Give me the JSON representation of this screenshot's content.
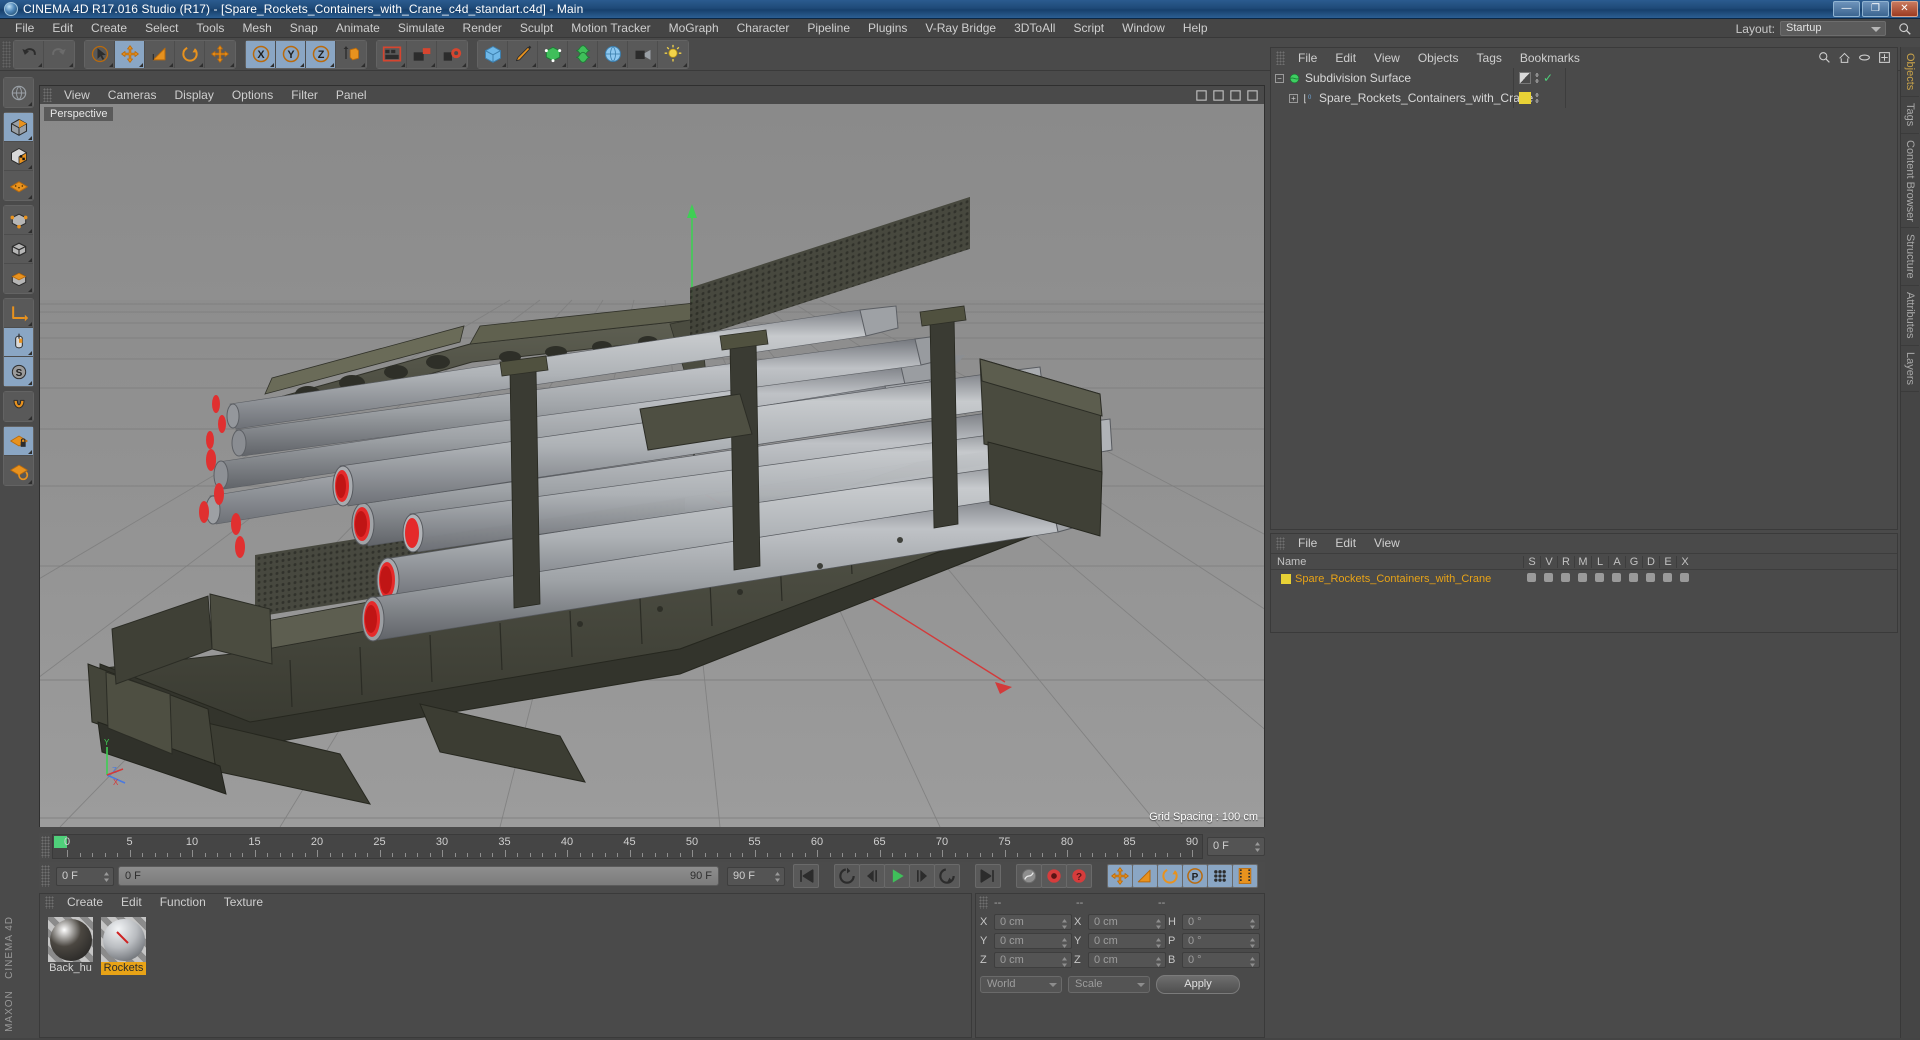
{
  "window": {
    "title": "CINEMA 4D R17.016 Studio (R17) - [Spare_Rockets_Containers_with_Crane_c4d_standart.c4d] - Main",
    "minimize": "—",
    "maximize": "❐",
    "close": "✕"
  },
  "menubar": {
    "items": [
      "File",
      "Edit",
      "Create",
      "Select",
      "Tools",
      "Mesh",
      "Snap",
      "Animate",
      "Simulate",
      "Render",
      "Sculpt",
      "Motion Tracker",
      "MoGraph",
      "Character",
      "Pipeline",
      "Plugins",
      "V-Ray Bridge",
      "3DToAll",
      "Script",
      "Window",
      "Help"
    ],
    "layout_label": "Layout:",
    "layout_value": "Startup",
    "search_icon": "search-icon"
  },
  "toolbar": {
    "groups": [
      {
        "name": "undo-redo",
        "buttons": [
          {
            "icon": "undo-icon",
            "label": "Undo",
            "selected": false
          },
          {
            "icon": "redo-icon",
            "label": "Redo",
            "selected": false
          }
        ]
      },
      {
        "name": "transform-tools",
        "buttons": [
          {
            "icon": "select-cursor-icon",
            "label": "Live Selection",
            "selected": false
          },
          {
            "icon": "move-icon",
            "label": "Move",
            "selected": true
          },
          {
            "icon": "scale-icon",
            "label": "Scale",
            "selected": false
          },
          {
            "icon": "rotate-icon",
            "label": "Rotate",
            "selected": false
          },
          {
            "icon": "move-axis-icon",
            "label": "Move Axis",
            "selected": false
          }
        ]
      },
      {
        "name": "axis-locks",
        "buttons": [
          {
            "icon": "x-axis-icon",
            "label": "X Axis",
            "selected": true
          },
          {
            "icon": "y-axis-icon",
            "label": "Y Axis",
            "selected": true
          },
          {
            "icon": "z-axis-icon",
            "label": "Z Axis",
            "selected": true
          },
          {
            "icon": "world-object-coord-icon",
            "label": "World/Object",
            "selected": false
          }
        ]
      },
      {
        "name": "render-tools",
        "buttons": [
          {
            "icon": "render-view-icon",
            "label": "Render View",
            "selected": false
          },
          {
            "icon": "render-to-picture-viewer-icon",
            "label": "Render to Picture Viewer",
            "selected": false
          },
          {
            "icon": "render-settings-icon",
            "label": "Edit Render Settings",
            "selected": false
          }
        ]
      },
      {
        "name": "object-creation",
        "buttons": [
          {
            "icon": "cube-primitive-icon",
            "label": "Add Cube Object",
            "selected": false
          },
          {
            "icon": "pen-spline-icon",
            "label": "Add Spline",
            "selected": false
          },
          {
            "icon": "nurbs-generator-icon",
            "label": "Add Generator",
            "selected": false
          },
          {
            "icon": "deformer-icon",
            "label": "Add Deformer",
            "selected": false
          },
          {
            "icon": "environment-icon",
            "label": "Add Environment",
            "selected": false
          },
          {
            "icon": "camera-icon",
            "label": "Add Camera",
            "selected": false
          },
          {
            "icon": "light-icon",
            "label": "Add Light",
            "selected": false
          }
        ]
      }
    ]
  },
  "leftbar": {
    "buttons": [
      {
        "icon": "globe-tool-icon",
        "label": "Selection Mode",
        "selected": false
      },
      {
        "icon": "model-mode-icon",
        "label": "Model Mode",
        "selected": true
      },
      {
        "icon": "texture-mode-icon",
        "label": "Texture Mode",
        "selected": false
      },
      {
        "icon": "workplane-icon",
        "label": "Workplane Mode",
        "selected": false
      },
      {
        "icon": "points-mode-icon",
        "label": "Points Mode",
        "selected": false
      },
      {
        "icon": "edges-mode-icon",
        "label": "Edges Mode",
        "selected": false
      },
      {
        "icon": "polygons-mode-icon",
        "label": "Polygons Mode",
        "selected": false
      },
      {
        "icon": "axis-modify-icon",
        "label": "Enable Axis Modification",
        "selected": false
      },
      {
        "icon": "viewport-solo-icon",
        "label": "Viewport Solo",
        "selected": true
      },
      {
        "icon": "soft-selection-icon",
        "label": "Soft Selection",
        "selected": true
      },
      {
        "icon": "magnet-snap-icon",
        "label": "Enable Snapping",
        "selected": false
      },
      {
        "icon": "workplane-lock-icon",
        "label": "Lock Workplane",
        "selected": true
      },
      {
        "icon": "planar-workplane-icon",
        "label": "Planar Workplane",
        "selected": false
      }
    ],
    "brand_line1": "MAXON",
    "brand_line2": "CINEMA 4D"
  },
  "viewport": {
    "menu_items": [
      "View",
      "Cameras",
      "Display",
      "Options",
      "Filter",
      "Panel"
    ],
    "label": "Perspective",
    "grid_spacing": "Grid Spacing : 100 cm",
    "axis_x": "X",
    "axis_y": "Y",
    "axis_z": "Z"
  },
  "timeline": {
    "start_label": "0 F",
    "ticks": [
      0,
      5,
      10,
      15,
      20,
      25,
      30,
      35,
      40,
      45,
      50,
      55,
      60,
      65,
      70,
      75,
      80,
      85,
      90
    ],
    "frame_field": "0 F",
    "range_start": "0 F",
    "range_end": "90 F",
    "end_field": "90 F",
    "transport": [
      {
        "icon": "go-to-start-icon",
        "label": "Go to Start Frame",
        "selected": false
      },
      {
        "icon": "previous-key-icon",
        "label": "Go to Previous Key",
        "selected": false
      },
      {
        "icon": "step-back-icon",
        "label": "Go to Previous Frame",
        "selected": false
      },
      {
        "icon": "play-icon",
        "label": "Play Forwards",
        "selected": false
      },
      {
        "icon": "step-forward-icon",
        "label": "Go to Next Frame",
        "selected": false
      },
      {
        "icon": "next-key-icon",
        "label": "Go to Next Key",
        "selected": false
      },
      {
        "icon": "go-to-end-icon",
        "label": "Go to End Frame",
        "selected": false
      }
    ],
    "record_group": [
      {
        "icon": "autokey-icon",
        "label": "Autokeying",
        "selected": false
      },
      {
        "icon": "record-icon",
        "label": "Record Active Objects",
        "selected": false
      },
      {
        "icon": "keyframe-selection-icon",
        "label": "Keyframe Selection",
        "selected": false
      }
    ],
    "param_group": [
      {
        "icon": "position-key-icon",
        "label": "Position",
        "selected": true
      },
      {
        "icon": "scale-key-icon",
        "label": "Scale",
        "selected": true
      },
      {
        "icon": "rotation-key-icon",
        "label": "Rotation",
        "selected": true
      },
      {
        "icon": "param-key-icon",
        "label": "Parameter",
        "selected": true
      },
      {
        "icon": "pla-key-icon",
        "label": "Point Level Animation",
        "selected": true
      },
      {
        "icon": "timeline-icon",
        "label": "Timeline",
        "selected": true
      }
    ]
  },
  "material_manager": {
    "menu_items": [
      "Create",
      "Edit",
      "Function",
      "Texture"
    ],
    "materials": [
      {
        "name": "Back_hu",
        "selected": false,
        "color": "#4b4741"
      },
      {
        "name": "Rockets",
        "selected": true,
        "color": "#b9bcc0"
      }
    ]
  },
  "object_manager": {
    "menu_items": [
      "File",
      "Edit",
      "View",
      "Objects",
      "Tags",
      "Bookmarks"
    ],
    "header_icons": [
      "search-icon",
      "home-icon",
      "eye-icon",
      "expand-icon"
    ],
    "rows": [
      {
        "name": "Subdivision Surface",
        "depth": 0,
        "expander": "−",
        "icon": "subdivision-surface-icon",
        "tag_swatch": "#8d8d8d",
        "check": "✓"
      },
      {
        "name": "Spare_Rockets_Containers_with_Crane",
        "depth": 1,
        "expander": "+",
        "icon": "null-object-icon",
        "tag_swatch": "#e8d236",
        "check": ""
      }
    ]
  },
  "layer_manager": {
    "menu_items": [
      "File",
      "Edit",
      "View"
    ],
    "columns": [
      "Name",
      "S",
      "V",
      "R",
      "M",
      "L",
      "A",
      "G",
      "D",
      "E",
      "X"
    ],
    "rows": [
      {
        "name": "Spare_Rockets_Containers_with_Crane",
        "color": "#e8d236"
      }
    ]
  },
  "coordinates": {
    "header": [
      "--",
      "--",
      "--"
    ],
    "rows": [
      {
        "l1": "X",
        "v1": "0 cm",
        "l2": "X",
        "v2": "0 cm",
        "l3": "H",
        "v3": "0 °"
      },
      {
        "l1": "Y",
        "v1": "0 cm",
        "l2": "Y",
        "v2": "0 cm",
        "l3": "P",
        "v3": "0 °"
      },
      {
        "l1": "Z",
        "v1": "0 cm",
        "l2": "Z",
        "v2": "0 cm",
        "l3": "B",
        "v3": "0 °"
      }
    ],
    "coord_system": "World",
    "mode": "Scale",
    "apply": "Apply"
  },
  "right_tabs": [
    {
      "label": "Objects",
      "active": true
    },
    {
      "label": "Tags",
      "active": false
    },
    {
      "label": "Content Browser",
      "active": false
    },
    {
      "label": "Structure",
      "active": false
    },
    {
      "label": "Attributes",
      "active": false
    },
    {
      "label": "Layers",
      "active": false
    }
  ]
}
